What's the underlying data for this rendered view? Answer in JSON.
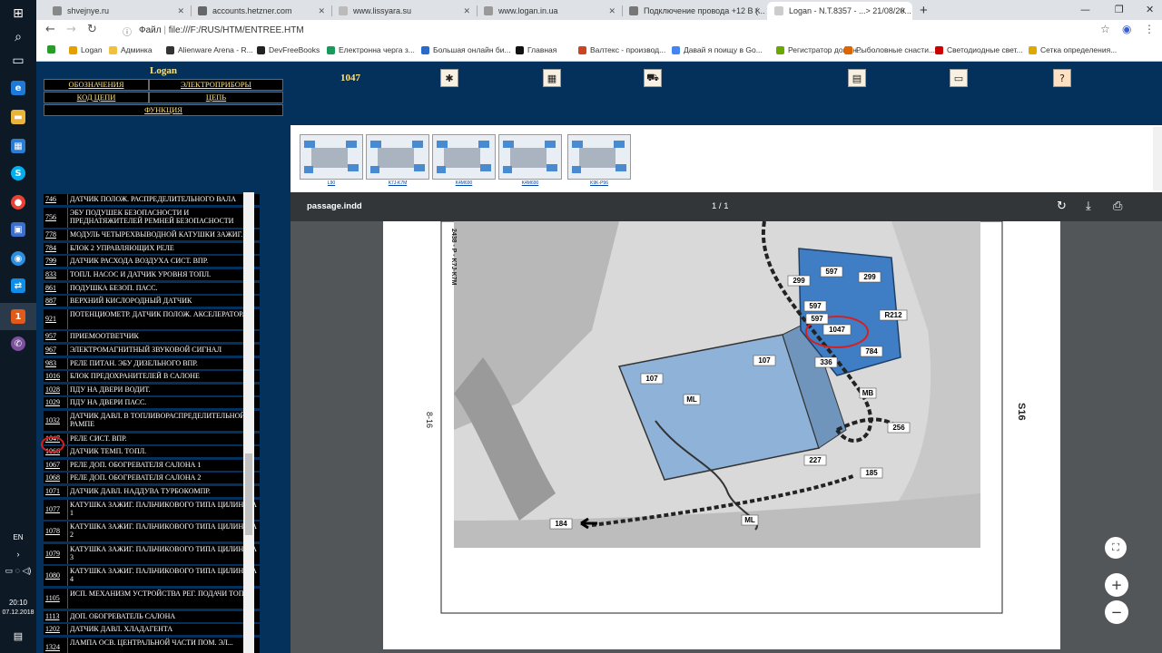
{
  "taskbar": {
    "lang": "EN",
    "time": "20:10",
    "date": "07.12.2018"
  },
  "tabs": [
    {
      "label": "shvejnye.ru"
    },
    {
      "label": "accounts.hetzner.com"
    },
    {
      "label": "www.lissyara.su"
    },
    {
      "label": "www.logan.in.ua"
    },
    {
      "label": "Подключение провода +12 В (..."
    },
    {
      "label": "Logan - N.T.8357 - ...> 21/08/20..."
    }
  ],
  "address": {
    "url": "file:///F:/RUS/HTM/ENTREE.HTM",
    "scheme": "Файл"
  },
  "bookmarks": [
    {
      "label": "Logan",
      "color": "#e2a100"
    },
    {
      "label": "Админка",
      "color": "#f0c040"
    },
    {
      "label": "Alienware Arena - R...",
      "color": "#333333"
    },
    {
      "label": "DevFreeBooks",
      "color": "#222222"
    },
    {
      "label": "Електронна черга з...",
      "color": "#1a9a5a"
    },
    {
      "label": "Большая онлайн би...",
      "color": "#2a6ac8"
    },
    {
      "label": "Главная",
      "color": "#111111"
    },
    {
      "label": "Валтекс - производ...",
      "color": "#cc4422"
    },
    {
      "label": "Давай я поищу в Go...",
      "color": "#4285f4"
    },
    {
      "label": "Регистратор домен...",
      "color": "#6aa800"
    },
    {
      "label": "Рыболовные снасти...",
      "color": "#dd6600"
    },
    {
      "label": "Светодиодные свет...",
      "color": "#cc0000"
    },
    {
      "label": "Сетка определения...",
      "color": "#ddaa00"
    }
  ],
  "leftnav": {
    "title": "Logan",
    "links": {
      "designations": "ОБОЗНАЧЕНИЯ",
      "devices": "ЭЛЕКТРОПРИБОРЫ",
      "circuit_code": "КОД ЦЕПИ",
      "circuit": "ЦЕПЬ",
      "function": "ФУНКЦИЯ"
    }
  },
  "components": [
    {
      "code": "746",
      "name": "ДАТЧИК ПОЛОЖ. РАСПРЕДЕЛИТЕЛЬНОГО ВАЛА"
    },
    {
      "code": "756",
      "name": "ЭБУ ПОДУШЕК БЕЗОПАСНОСТИ И ПРЕДНАТЯЖИТЕЛЕЙ РЕМНЕЙ БЕЗОПАСНОСТИ"
    },
    {
      "code": "778",
      "name": "МОДУЛЬ ЧЕТЫРЕХВЫВОДНОЙ КАТУШКИ ЗАЖИГ."
    },
    {
      "code": "784",
      "name": "БЛОК 2 УПРАВЛЯЮЩИХ РЕЛЕ"
    },
    {
      "code": "799",
      "name": "ДАТЧИК РАСХОДА ВОЗДУХА СИСТ. ВПР."
    },
    {
      "code": "833",
      "name": "ТОПЛ. НАСОС И ДАТЧИК УРОВНЯ ТОПЛ."
    },
    {
      "code": "861",
      "name": "ПОДУШКА БЕЗОП. ПАСС."
    },
    {
      "code": "887",
      "name": "ВЕРХНИЙ КИСЛОРОДНЫЙ ДАТЧИК"
    },
    {
      "code": "921",
      "name": "ПОТЕНЦИОМЕТР. ДАТЧИК ПОЛОЖ. АКСЕЛЕРАТОРА"
    },
    {
      "code": "957",
      "name": "ПРИЕМООТВЕТЧИК"
    },
    {
      "code": "967",
      "name": "ЭЛЕКТРОМАГНИТНЫЙ ЗВУКОВОЙ СИГНАЛ"
    },
    {
      "code": "983",
      "name": "РЕЛЕ ПИТАН. ЭБУ ДИЗЕЛЬНОГО ВПР."
    },
    {
      "code": "1016",
      "name": "БЛОК ПРЕДОХРАНИТЕЛЕЙ В САЛОНЕ"
    },
    {
      "code": "1028",
      "name": "ПДУ НА ДВЕРИ ВОДИТ."
    },
    {
      "code": "1029",
      "name": "ПДУ НА ДВЕРИ ПАСС."
    },
    {
      "code": "1032",
      "name": "ДАТЧИК ДАВЛ. В ТОПЛИВОРАСПРЕДЕЛИТЕЛЬНОЙ РАМПЕ"
    },
    {
      "code": "1047",
      "name": "РЕЛЕ СИСТ. ВПР."
    },
    {
      "code": "1066",
      "name": "ДАТЧИК ТЕМП. ТОПЛ."
    },
    {
      "code": "1067",
      "name": "РЕЛЕ ДОП. ОБОГРЕВАТЕЛЯ САЛОНА 1"
    },
    {
      "code": "1068",
      "name": "РЕЛЕ ДОП. ОБОГРЕВАТЕЛЯ САЛОНА 2"
    },
    {
      "code": "1071",
      "name": "ДАТЧИК ДАВЛ. НАДДУВА ТУРБОКОМПР."
    },
    {
      "code": "1077",
      "name": "КАТУШКА ЗАЖИГ. ПАЛЬЧИКОВОГО ТИПА ЦИЛИНДРА 1"
    },
    {
      "code": "1078",
      "name": "КАТУШКА ЗАЖИГ. ПАЛЬЧИКОВОГО ТИПА ЦИЛИНДРА 2"
    },
    {
      "code": "1079",
      "name": "КАТУШКА ЗАЖИГ. ПАЛЬЧИКОВОГО ТИПА ЦИЛИНДРА 3"
    },
    {
      "code": "1080",
      "name": "КАТУШКА ЗАЖИГ. ПАЛЬЧИКОВОГО ТИПА ЦИЛИНДРА 4"
    },
    {
      "code": "1105",
      "name": "ИСП. МЕХАНИЗМ УСТРОЙСТВА РЕГ. ПОДАЧИ ТОПЛ."
    },
    {
      "code": "1113",
      "name": "ДОП. ОБОГРЕВАТЕЛЬ САЛОНА"
    },
    {
      "code": "1202",
      "name": "ДАТЧИК ДАВЛ. ХЛАДАГЕНТА"
    },
    {
      "code": "1324",
      "name": "ЛАМПА ОСВ. ЦЕНТРАЛЬНОЙ ЧАСТИ ПОМ. ЭЛ..."
    }
  ],
  "selected_code": "1047",
  "topbar": {
    "code": "1047"
  },
  "thumbnails": [
    {
      "label": "L90"
    },
    {
      "label": "K7J-K7M"
    },
    {
      "label": "K4M690"
    },
    {
      "label": "K4M690"
    },
    {
      "label": "K9K-P96"
    }
  ],
  "pdf": {
    "filename": "passage.indd",
    "page": "1 / 1"
  },
  "diagram": {
    "side_left": "8-16",
    "side_right": "S16",
    "vertical_code": "2438 - P - K7J-K7M",
    "labels": [
      "299",
      "597",
      "299",
      "597",
      "597",
      "1047",
      "R212",
      "784",
      "336",
      "107",
      "107",
      "ML",
      "MB",
      "256",
      "227",
      "185",
      "ML",
      "184"
    ]
  }
}
